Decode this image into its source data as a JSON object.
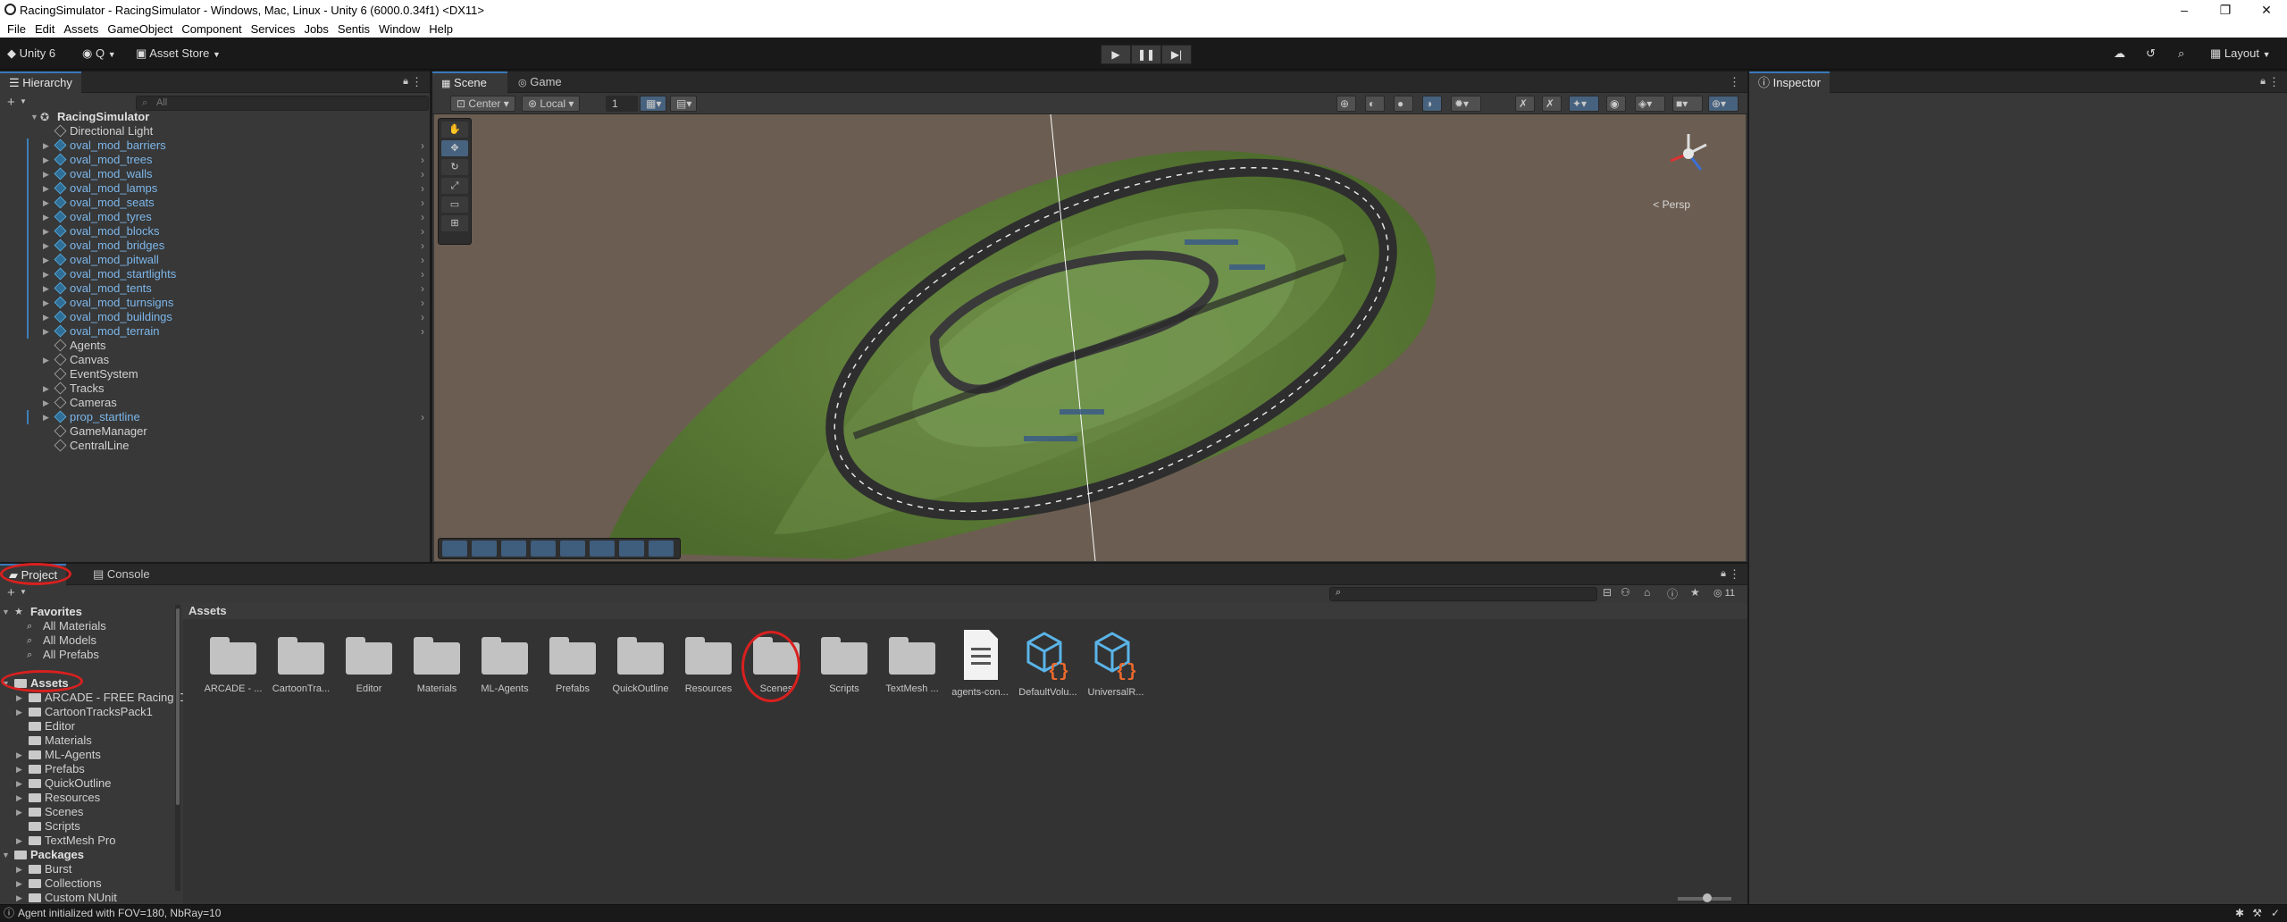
{
  "window": {
    "title": "RacingSimulator - RacingSimulator - Windows, Mac, Linux - Unity 6 (6000.0.34f1) <DX11>",
    "controls": [
      "–",
      "❐",
      "✕"
    ]
  },
  "menu": [
    "File",
    "Edit",
    "Assets",
    "GameObject",
    "Component",
    "Services",
    "Jobs",
    "Sentis",
    "Window",
    "Help"
  ],
  "toolbar": {
    "unity_label": "Unity 6",
    "account_label": "Q",
    "asset_store_label": "Asset Store",
    "layout_label": "Layout",
    "play_icons": [
      "▶",
      "❚❚",
      "▶|"
    ]
  },
  "hierarchy": {
    "tab_label": "Hierarchy",
    "search_placeholder": "All",
    "scene_name": "RacingSimulator",
    "items": [
      {
        "label": "Directional Light",
        "prefab": false,
        "expandable": false
      },
      {
        "label": "oval_mod_barriers",
        "prefab": true,
        "expandable": true
      },
      {
        "label": "oval_mod_trees",
        "prefab": true,
        "expandable": true
      },
      {
        "label": "oval_mod_walls",
        "prefab": true,
        "expandable": true
      },
      {
        "label": "oval_mod_lamps",
        "prefab": true,
        "expandable": true
      },
      {
        "label": "oval_mod_seats",
        "prefab": true,
        "expandable": true
      },
      {
        "label": "oval_mod_tyres",
        "prefab": true,
        "expandable": true
      },
      {
        "label": "oval_mod_blocks",
        "prefab": true,
        "expandable": true
      },
      {
        "label": "oval_mod_bridges",
        "prefab": true,
        "expandable": true
      },
      {
        "label": "oval_mod_pitwall",
        "prefab": true,
        "expandable": true
      },
      {
        "label": "oval_mod_startlights",
        "prefab": true,
        "expandable": true
      },
      {
        "label": "oval_mod_tents",
        "prefab": true,
        "expandable": true
      },
      {
        "label": "oval_mod_turnsigns",
        "prefab": true,
        "expandable": true
      },
      {
        "label": "oval_mod_buildings",
        "prefab": true,
        "expandable": true
      },
      {
        "label": "oval_mod_terrain",
        "prefab": true,
        "expandable": true
      },
      {
        "label": "Agents",
        "prefab": false,
        "expandable": false
      },
      {
        "label": "Canvas",
        "prefab": false,
        "expandable": true
      },
      {
        "label": "EventSystem",
        "prefab": false,
        "expandable": false
      },
      {
        "label": "Tracks",
        "prefab": false,
        "expandable": true
      },
      {
        "label": "Cameras",
        "prefab": false,
        "expandable": true
      },
      {
        "label": "prop_startline",
        "prefab": true,
        "expandable": true
      },
      {
        "label": "GameManager",
        "prefab": false,
        "expandable": false
      },
      {
        "label": "CentralLine",
        "prefab": false,
        "expandable": false
      }
    ]
  },
  "scene": {
    "tabs": [
      "Scene",
      "Game"
    ],
    "pivot_label": "Center",
    "space_label": "Local",
    "snap_value": "1",
    "gizmo_persp_label": "< Persp"
  },
  "inspector": {
    "tab_label": "Inspector"
  },
  "project": {
    "tabs": [
      "Project",
      "Console"
    ],
    "breadcrumb": "Assets",
    "hidden_count": "11",
    "favorites_label": "Favorites",
    "favorites": [
      "All Materials",
      "All Models",
      "All Prefabs"
    ],
    "assets_label": "Assets",
    "asset_folders": [
      "ARCADE - FREE Racing C",
      "CartoonTracksPack1",
      "Editor",
      "Materials",
      "ML-Agents",
      "Prefabs",
      "QuickOutline",
      "Resources",
      "Scenes",
      "Scripts",
      "TextMesh Pro"
    ],
    "packages_label": "Packages",
    "packages": [
      "Burst",
      "Collections",
      "Custom NUnit"
    ],
    "grid_items": [
      {
        "name": "ARCADE - ...",
        "kind": "folder"
      },
      {
        "name": "CartoonTra...",
        "kind": "folder"
      },
      {
        "name": "Editor",
        "kind": "folder"
      },
      {
        "name": "Materials",
        "kind": "folder"
      },
      {
        "name": "ML-Agents",
        "kind": "folder"
      },
      {
        "name": "Prefabs",
        "kind": "folder"
      },
      {
        "name": "QuickOutline",
        "kind": "folder"
      },
      {
        "name": "Resources",
        "kind": "folder"
      },
      {
        "name": "Scenes",
        "kind": "folder"
      },
      {
        "name": "Scripts",
        "kind": "folder"
      },
      {
        "name": "TextMesh ...",
        "kind": "folder"
      },
      {
        "name": "agents-con...",
        "kind": "text-file"
      },
      {
        "name": "DefaultVolu...",
        "kind": "json-asset"
      },
      {
        "name": "UniversalR...",
        "kind": "json-asset"
      }
    ]
  },
  "status": {
    "message": "Agent initialized with FOV=180, NbRay=10"
  },
  "colors": {
    "accent": "#3a79bb",
    "prefab_text": "#7cb6ea",
    "annotation_red": "#d9201f"
  }
}
